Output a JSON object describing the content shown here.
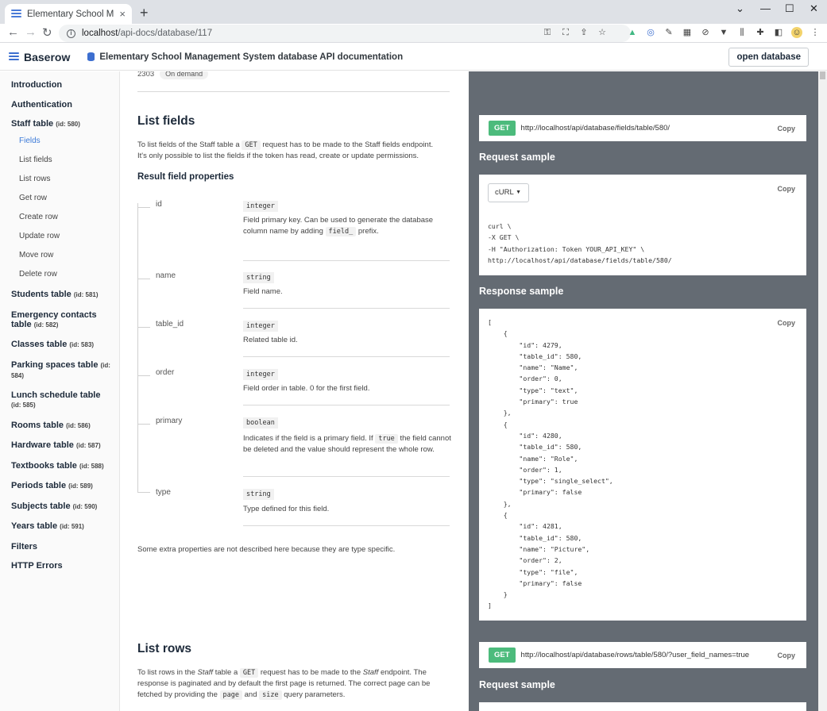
{
  "browser": {
    "tab_title": "Elementary School Management",
    "tab_close": "×",
    "new_tab": "+",
    "url_host": "localhost",
    "url_path": "/api-docs/database/117",
    "window_controls": [
      "⌄",
      "—",
      "☐",
      "✕"
    ]
  },
  "header": {
    "brand": "Baserow",
    "db_title": "Elementary School Management System database API documentation",
    "open_button": "open database"
  },
  "sidebar": {
    "items": [
      {
        "label": "Introduction",
        "tid": ""
      },
      {
        "label": "Authentication",
        "tid": ""
      },
      {
        "label": "Staff table",
        "tid": "(id: 580)"
      },
      {
        "label": "Students table",
        "tid": "(id: 581)"
      },
      {
        "label": "Emergency contacts table",
        "tid": "(id: 582)"
      },
      {
        "label": "Classes table",
        "tid": "(id: 583)"
      },
      {
        "label": "Parking spaces table",
        "tid": "(id: 584)"
      },
      {
        "label": "Lunch schedule table",
        "tid": "(id: 585)"
      },
      {
        "label": "Rooms table",
        "tid": "(id: 586)"
      },
      {
        "label": "Hardware table",
        "tid": "(id: 587)"
      },
      {
        "label": "Textbooks table",
        "tid": "(id: 588)"
      },
      {
        "label": "Periods table",
        "tid": "(id: 589)"
      },
      {
        "label": "Subjects table",
        "tid": "(id: 590)"
      },
      {
        "label": "Years table",
        "tid": "(id: 591)"
      },
      {
        "label": "Filters",
        "tid": ""
      },
      {
        "label": "HTTP Errors",
        "tid": ""
      }
    ],
    "subitems": [
      "Fields",
      "List fields",
      "List rows",
      "Get row",
      "Create row",
      "Update row",
      "Move row",
      "Delete row"
    ]
  },
  "content": {
    "prev_id": "2303",
    "prev_pill": "On demand",
    "list_fields": {
      "title": "List fields",
      "desc_1": "To list fields of the Staff table a",
      "desc_code": "GET",
      "desc_2": "request has to be made to the Staff fields endpoint. It's only possible to list the fields if the token has read, create or update permissions.",
      "props_title": "Result field properties",
      "fields": [
        {
          "name": "id",
          "type": "integer",
          "desc": "Field primary key. Can be used to generate the database column name by adding",
          "code": "field_",
          "desc_after": "prefix."
        },
        {
          "name": "name",
          "type": "string",
          "desc": "Field name."
        },
        {
          "name": "table_id",
          "type": "integer",
          "desc": "Related table id."
        },
        {
          "name": "order",
          "type": "integer",
          "desc": "Field order in table. 0 for the first field."
        },
        {
          "name": "primary",
          "type": "boolean",
          "desc": "Indicates if the field is a primary field. If",
          "code": "true",
          "desc_after": "the field cannot be deleted and the value should represent the whole row."
        },
        {
          "name": "type",
          "type": "string",
          "desc": "Type defined for this field."
        }
      ],
      "extra": "Some extra properties are not described here because they are type specific."
    },
    "list_rows": {
      "title": "List rows",
      "p1": "To list rows in the",
      "p1_em": "Staff",
      "p2": "table a",
      "p2_code": "GET",
      "p3": "request has to be made to the",
      "p3_em": "Staff",
      "p4": "endpoint. The response is paginated and by default the first page is returned. The correct page can be fetched by providing the",
      "code_page": "page",
      "and": "and",
      "code_size": "size",
      "p5": "query parameters."
    }
  },
  "right": {
    "get": "GET",
    "copy": "Copy",
    "fields_url": "http://localhost/api/database/fields/table/580/",
    "request_title": "Request sample",
    "lang": "cURL",
    "caret": "▼",
    "curl": "curl \\\n-X GET \\\n-H \"Authorization: Token YOUR_API_KEY\" \\\nhttp://localhost/api/database/fields/table/580/",
    "response_title": "Response sample",
    "response": "[\n    {\n        \"id\": 4279,\n        \"table_id\": 580,\n        \"name\": \"Name\",\n        \"order\": 0,\n        \"type\": \"text\",\n        \"primary\": true\n    },\n    {\n        \"id\": 4280,\n        \"table_id\": 580,\n        \"name\": \"Role\",\n        \"order\": 1,\n        \"type\": \"single_select\",\n        \"primary\": false\n    },\n    {\n        \"id\": 4281,\n        \"table_id\": 580,\n        \"name\": \"Picture\",\n        \"order\": 2,\n        \"type\": \"file\",\n        \"primary\": false\n    }\n]",
    "rows_url": "http://localhost/api/database/rows/table/580/?user_field_names=true",
    "request_title_2": "Request sample"
  },
  "colors": {
    "get_badge": "#4cbb7c",
    "panel": "#646b73",
    "active_link": "#3d7bd8"
  }
}
